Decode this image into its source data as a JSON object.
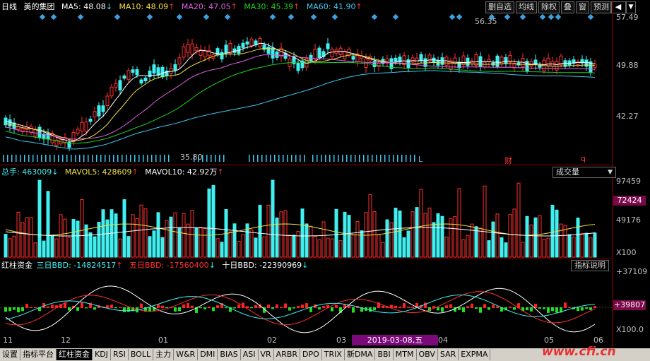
{
  "price_panel": {
    "period": "日线",
    "stock_name": "美的集团",
    "ma": [
      {
        "label": "MA5: 48.08",
        "arrow": "↓",
        "color": "#ffffff"
      },
      {
        "label": "MA10: 48.09",
        "arrow": "↑",
        "color": "#f0e040"
      },
      {
        "label": "MA20: 47.05",
        "arrow": "↑",
        "color": "#e060e0"
      },
      {
        "label": "MA30: 45.39",
        "arrow": "↑",
        "color": "#20d020"
      },
      {
        "label": "MA60: 41.90",
        "arrow": "↑",
        "color": "#40c8f0"
      }
    ],
    "buttons": [
      "删自选",
      "均线",
      "除权",
      "叠",
      "窗",
      "预测"
    ],
    "nav_button": "◀",
    "nav_button2": "▼",
    "y_ticks": [
      "57.49",
      "49.88",
      "42.27"
    ],
    "high_annotation": "56.35",
    "low_annotation": "35.80",
    "marker_cai": "财",
    "marker_q": "q",
    "marker_L": "L"
  },
  "volume_panel": {
    "total_label": "总手: 463009",
    "total_arrow": "↓",
    "mavol5_label": "MAVOL5: 428609",
    "mavol5_arrow": "↑",
    "mavol10_label": "MAVOL10: 42.92万",
    "mavol10_arrow": "↑",
    "dropdown": "成交量",
    "y_ticks": [
      "97459",
      "49176",
      "X100"
    ],
    "highlight_value": "72424"
  },
  "indicator_panel": {
    "name": "红柱资金",
    "bbd3_label": "三日BBD: -14824517",
    "bbd3_arrow": "↑",
    "bbd5_label": "五日BBD: -17560400",
    "bbd5_arrow": "↓",
    "bbd10_label": "十日BBD: -22390969",
    "bbd10_arrow": "↓",
    "help_button": "指标说明",
    "y_ticks": [
      "+37109",
      "+39807",
      "X100.0"
    ],
    "selected_date": "2019-03-08,五"
  },
  "x_axis": [
    "11",
    "12",
    "01",
    "02",
    "03",
    "04",
    "05",
    "06"
  ],
  "tabs": [
    "设置",
    "指标平台",
    "红柱资金",
    "KDJ",
    "RSI",
    "BOLL",
    "主力",
    "W&R",
    "DMI",
    "BIAS",
    "ASI",
    "VR",
    "ARBR",
    "DPO",
    "TRIX",
    "新DMA",
    "BBI",
    "MTM",
    "OBV",
    "SAR",
    "EXPMA"
  ],
  "active_tab": "红柱资金",
  "watermark": "www.cfi.cn",
  "colors": {
    "up": "#ff3030",
    "down": "#40f0f0",
    "ma5": "#ffffff",
    "ma10": "#f0e040",
    "ma20": "#e060e0",
    "ma30": "#20d020",
    "ma60": "#40c8f0",
    "bbd_bar_up": "#ff2020",
    "bbd_bar_down": "#20e020"
  }
}
